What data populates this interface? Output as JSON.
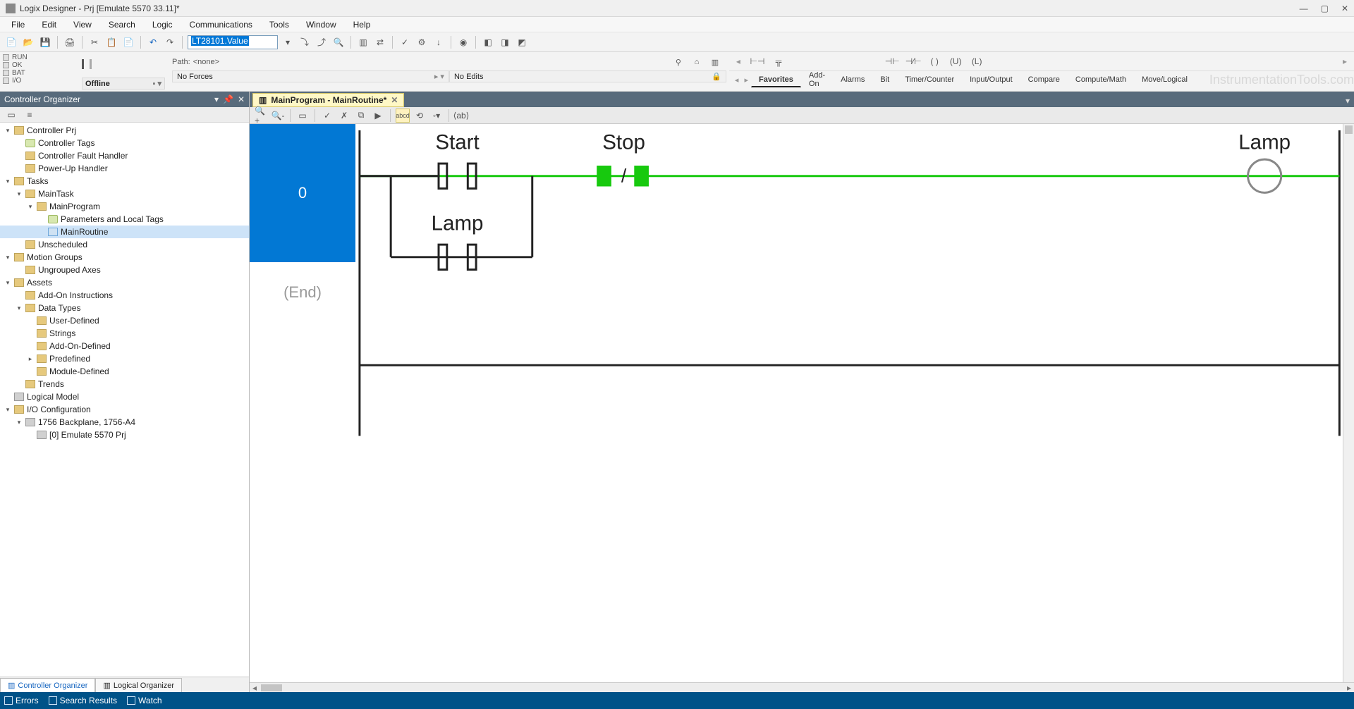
{
  "title": "Logix Designer - Prj [Emulate 5570 33.11]*",
  "menu": [
    "File",
    "Edit",
    "View",
    "Search",
    "Logic",
    "Communications",
    "Tools",
    "Window",
    "Help"
  ],
  "tag_input": "LT28101.Value",
  "status_lights": [
    "RUN",
    "OK",
    "BAT",
    "I/O"
  ],
  "mode": "Offline",
  "forces": "No Forces",
  "edits": "No Edits",
  "path_label": "Path:",
  "path_value": "<none>",
  "inst_tabs": [
    "Favorites",
    "Add-On",
    "Alarms",
    "Bit",
    "Timer/Counter",
    "Input/Output",
    "Compare",
    "Compute/Math",
    "Move/Logical"
  ],
  "watermark": "InstrumentationTools.com",
  "org_title": "Controller Organizer",
  "tree": [
    {
      "indent": 0,
      "twisty": "▾",
      "icon": "folder",
      "label": "Controller Prj"
    },
    {
      "indent": 1,
      "twisty": " ",
      "icon": "tag",
      "label": "Controller Tags"
    },
    {
      "indent": 1,
      "twisty": " ",
      "icon": "folder",
      "label": "Controller Fault Handler"
    },
    {
      "indent": 1,
      "twisty": " ",
      "icon": "folder",
      "label": "Power-Up Handler"
    },
    {
      "indent": 0,
      "twisty": "▾",
      "icon": "folder",
      "label": "Tasks"
    },
    {
      "indent": 1,
      "twisty": "▾",
      "icon": "folder",
      "label": "MainTask"
    },
    {
      "indent": 2,
      "twisty": "▾",
      "icon": "folder",
      "label": "MainProgram"
    },
    {
      "indent": 3,
      "twisty": " ",
      "icon": "tag",
      "label": "Parameters and Local Tags"
    },
    {
      "indent": 3,
      "twisty": " ",
      "icon": "rout",
      "label": "MainRoutine",
      "sel": true
    },
    {
      "indent": 1,
      "twisty": " ",
      "icon": "folder",
      "label": "Unscheduled"
    },
    {
      "indent": 0,
      "twisty": "▾",
      "icon": "folder",
      "label": "Motion Groups"
    },
    {
      "indent": 1,
      "twisty": " ",
      "icon": "folder",
      "label": "Ungrouped Axes"
    },
    {
      "indent": 0,
      "twisty": "▾",
      "icon": "folder",
      "label": "Assets"
    },
    {
      "indent": 1,
      "twisty": " ",
      "icon": "folder",
      "label": "Add-On Instructions"
    },
    {
      "indent": 1,
      "twisty": "▾",
      "icon": "folder",
      "label": "Data Types"
    },
    {
      "indent": 2,
      "twisty": " ",
      "icon": "folder",
      "label": "User-Defined"
    },
    {
      "indent": 2,
      "twisty": " ",
      "icon": "folder",
      "label": "Strings"
    },
    {
      "indent": 2,
      "twisty": " ",
      "icon": "folder",
      "label": "Add-On-Defined"
    },
    {
      "indent": 2,
      "twisty": "▸",
      "icon": "folder",
      "label": "Predefined"
    },
    {
      "indent": 2,
      "twisty": " ",
      "icon": "folder",
      "label": "Module-Defined"
    },
    {
      "indent": 1,
      "twisty": " ",
      "icon": "folder",
      "label": "Trends"
    },
    {
      "indent": 0,
      "twisty": " ",
      "icon": "mod",
      "label": "Logical Model"
    },
    {
      "indent": 0,
      "twisty": "▾",
      "icon": "folder",
      "label": "I/O Configuration"
    },
    {
      "indent": 1,
      "twisty": "▾",
      "icon": "mod",
      "label": "1756 Backplane, 1756-A4"
    },
    {
      "indent": 2,
      "twisty": " ",
      "icon": "mod",
      "label": "[0] Emulate 5570 Prj"
    }
  ],
  "org_tabs": [
    "Controller Organizer",
    "Logical Organizer"
  ],
  "editor_tab": "MainProgram - MainRoutine*",
  "rung_number": "0",
  "end_label": "(End)",
  "ladder": {
    "start_label": "Start",
    "stop_label": "Stop",
    "lamp_label": "Lamp",
    "seal_label": "Lamp"
  },
  "statusbar": [
    "Errors",
    "Search Results",
    "Watch"
  ]
}
